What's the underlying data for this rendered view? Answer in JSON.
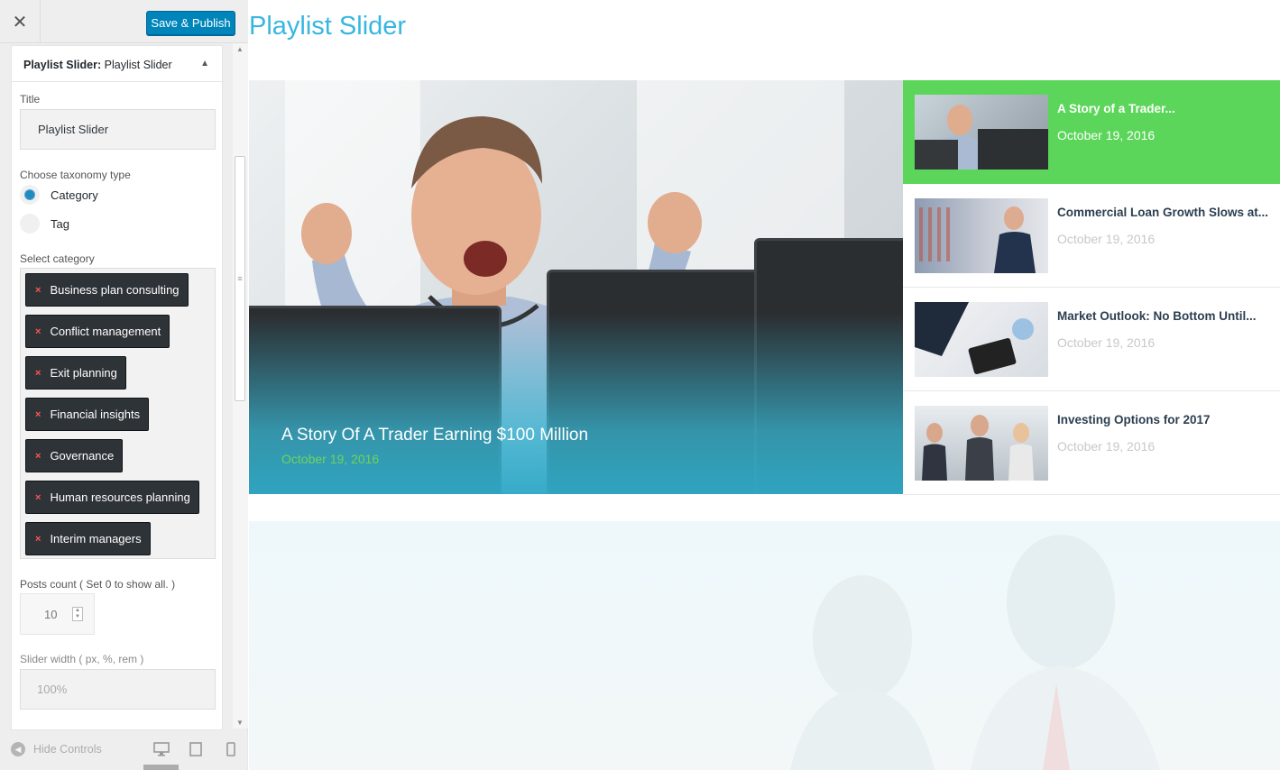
{
  "sidebar": {
    "close_glyph": "✕",
    "publish_label": "Save & Publish",
    "panel_type": "Playlist Slider:",
    "panel_name": " Playlist Slider",
    "title_label": "Title",
    "title_value": "Playlist Slider",
    "taxonomy_label": "Choose taxonomy type",
    "taxonomy_options": [
      "Category",
      "Tag"
    ],
    "taxonomy_selected": "Category",
    "category_label": "Select category",
    "categories": [
      "Business plan consulting",
      "Conflict management",
      "Exit planning",
      "Financial insights",
      "Governance",
      "Human resources planning",
      "Interim managers"
    ],
    "chip_remove_glyph": "×",
    "posts_count_label": "Posts count ( Set 0 to show all. )",
    "posts_count_value": "10",
    "slider_width_label": "Slider width ( px, %, rem )",
    "slider_width_value": "100%",
    "hide_controls_label": "Hide Controls",
    "hide_controls_glyph": "◀"
  },
  "preview": {
    "title": "Playlist Slider",
    "hero": {
      "caption": "A Story Of A Trader Earning $100 Million",
      "date": "October 19, 2016"
    },
    "playlist": [
      {
        "title": "A Story of a Trader...",
        "date": "October 19, 2016",
        "active": true
      },
      {
        "title": "Commercial Loan Growth Slows at...",
        "date": "October 19, 2016",
        "active": false
      },
      {
        "title": "Market Outlook: No Bottom Until...",
        "date": "October 19, 2016",
        "active": false
      },
      {
        "title": "Investing Options for 2017",
        "date": "October 19, 2016",
        "active": false
      }
    ]
  },
  "colors": {
    "accent_blue": "#0085ba",
    "title_blue": "#37b7e0",
    "active_green": "#5bd65a",
    "date_green": "#6fd35c"
  },
  "icons": [
    "close-icon",
    "collapse-arrow-icon",
    "remove-icon",
    "stepper-icon",
    "hide-controls-icon",
    "desktop-icon",
    "tablet-icon",
    "mobile-icon"
  ]
}
